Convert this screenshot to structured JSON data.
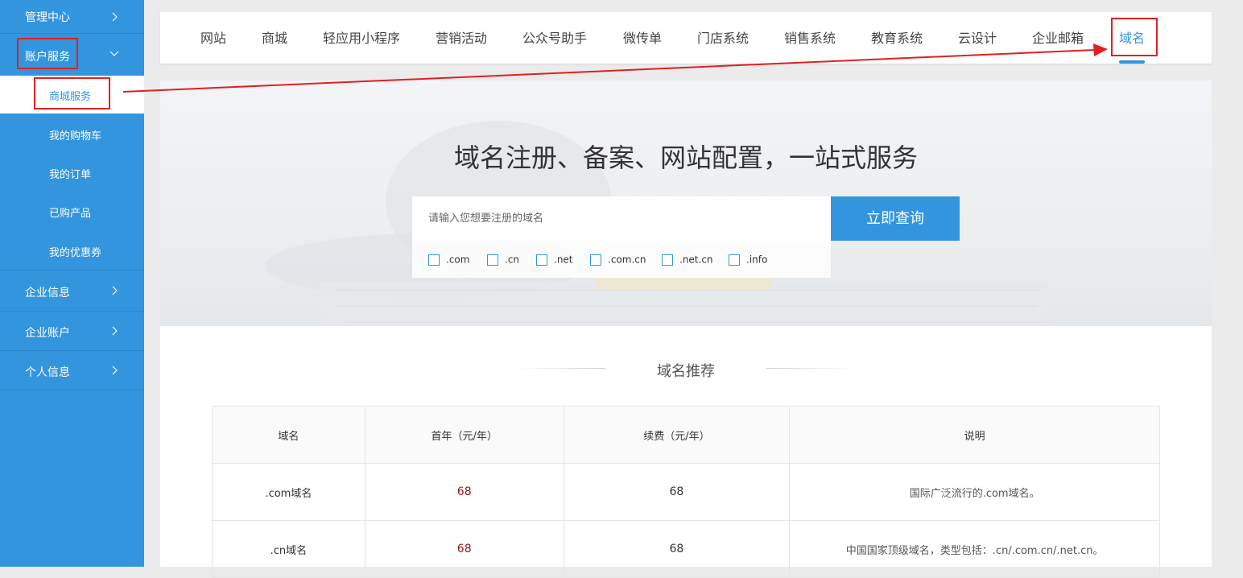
{
  "sidebar": {
    "items": [
      {
        "label": "管理中心"
      },
      {
        "label": "账户服务"
      },
      {
        "label": "企业信息"
      },
      {
        "label": "企业账户"
      },
      {
        "label": "个人信息"
      }
    ],
    "subitems": [
      {
        "label": "商城服务"
      },
      {
        "label": "我的购物车"
      },
      {
        "label": "我的订单"
      },
      {
        "label": "已购产品"
      },
      {
        "label": "我的优惠券"
      }
    ]
  },
  "topnav": {
    "tabs": [
      {
        "label": "网站"
      },
      {
        "label": "商城"
      },
      {
        "label": "轻应用小程序"
      },
      {
        "label": "营销活动"
      },
      {
        "label": "公众号助手"
      },
      {
        "label": "微传单"
      },
      {
        "label": "门店系统"
      },
      {
        "label": "销售系统"
      },
      {
        "label": "教育系统"
      },
      {
        "label": "云设计"
      },
      {
        "label": "企业邮箱"
      },
      {
        "label": "域名"
      }
    ],
    "active": "域名"
  },
  "hero": {
    "title": "域名注册、备案、网站配置，一站式服务",
    "search_placeholder": "请输入您想要注册的域名",
    "search_button": "立即查询",
    "extensions": [
      ".com",
      ".cn",
      ".net",
      ".com.cn",
      ".net.cn",
      ".info"
    ]
  },
  "section": {
    "title": "域名推荐"
  },
  "table": {
    "headers": [
      "域名",
      "首年（元/年）",
      "续费（元/年）",
      "说明"
    ],
    "rows": [
      {
        "name": ".com域名",
        "first_year": "68",
        "renewal": "68",
        "desc": "国际广泛流行的.com域名。"
      },
      {
        "name": ".cn域名",
        "first_year": "68",
        "renewal": "68",
        "desc": "中国国家顶级域名，类型包括：.cn/.com.cn/.net.cn。"
      }
    ]
  },
  "colors": {
    "brand": "#3395de",
    "highlight": "#e02020",
    "price": "#a31515"
  }
}
